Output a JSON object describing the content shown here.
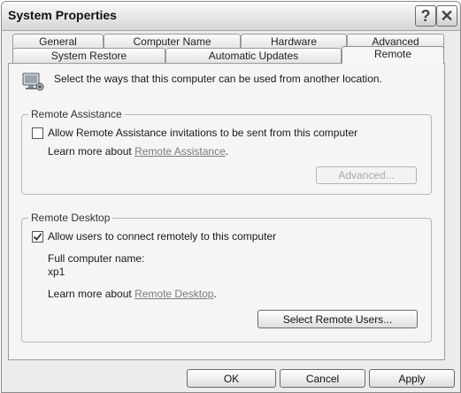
{
  "window": {
    "title": "System Properties",
    "help_glyph": "?",
    "close_glyph": "✕"
  },
  "tabs_row1": [
    "General",
    "Computer Name",
    "Hardware",
    "Advanced"
  ],
  "tabs_row2": [
    "System Restore",
    "Automatic Updates",
    "Remote"
  ],
  "active_tab": "Remote",
  "intro_text": "Select the ways that this computer can be used from another location.",
  "remote_assistance": {
    "legend": "Remote Assistance",
    "checkbox_label": "Allow Remote Assistance invitations to be sent from this computer",
    "checked": false,
    "learn_prefix": "Learn more about ",
    "learn_link": "Remote Assistance",
    "learn_suffix": ".",
    "advanced_button": "Advanced..."
  },
  "remote_desktop": {
    "legend": "Remote Desktop",
    "checkbox_label": "Allow users to connect remotely to this computer",
    "checked": true,
    "full_name_label": "Full computer name:",
    "computer_name": "xp1",
    "learn_prefix": "Learn more about ",
    "learn_link": "Remote Desktop",
    "learn_suffix": ".",
    "select_users_button": "Select Remote Users..."
  },
  "footer": {
    "ok": "OK",
    "cancel": "Cancel",
    "apply": "Apply"
  },
  "icons": {
    "monitor": "computer-monitor-icon",
    "check": "checkmark-icon"
  }
}
